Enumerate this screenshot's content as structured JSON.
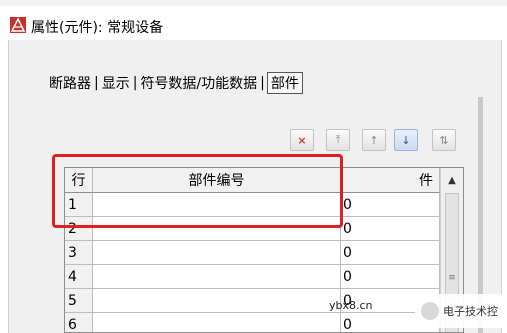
{
  "window": {
    "title": "属性(元件): 常规设备"
  },
  "tabs": [
    {
      "label": "断路器"
    },
    {
      "label": "显示"
    },
    {
      "label": "符号数据/功能数据"
    },
    {
      "label": "部件"
    }
  ],
  "tab_separator": "|",
  "toolbar": {
    "delete_icon": "×",
    "top_icon": "⤒",
    "up_icon": "↑",
    "down_icon": "↓",
    "bottom_icon": "⇅"
  },
  "table": {
    "columns": {
      "row": "行",
      "part_no": "部件编号",
      "qty_partial": "件"
    },
    "rows": [
      {
        "num": "1",
        "part": "",
        "qty": "0"
      },
      {
        "num": "2",
        "part": "",
        "qty": "0"
      },
      {
        "num": "3",
        "part": "",
        "qty": "0"
      },
      {
        "num": "4",
        "part": "",
        "qty": "0"
      },
      {
        "num": "5",
        "part": "",
        "qty": "0"
      },
      {
        "num": "6",
        "part": "",
        "qty": "0"
      }
    ],
    "scroll_up_icon": "▲",
    "grip_icon": "≡"
  },
  "watermark": {
    "site": "ybx8.cn",
    "brand": "电子技术控"
  },
  "colors": {
    "highlight": "#e02020",
    "delete": "#d23a2a",
    "down_active": "#2d5aa0"
  }
}
